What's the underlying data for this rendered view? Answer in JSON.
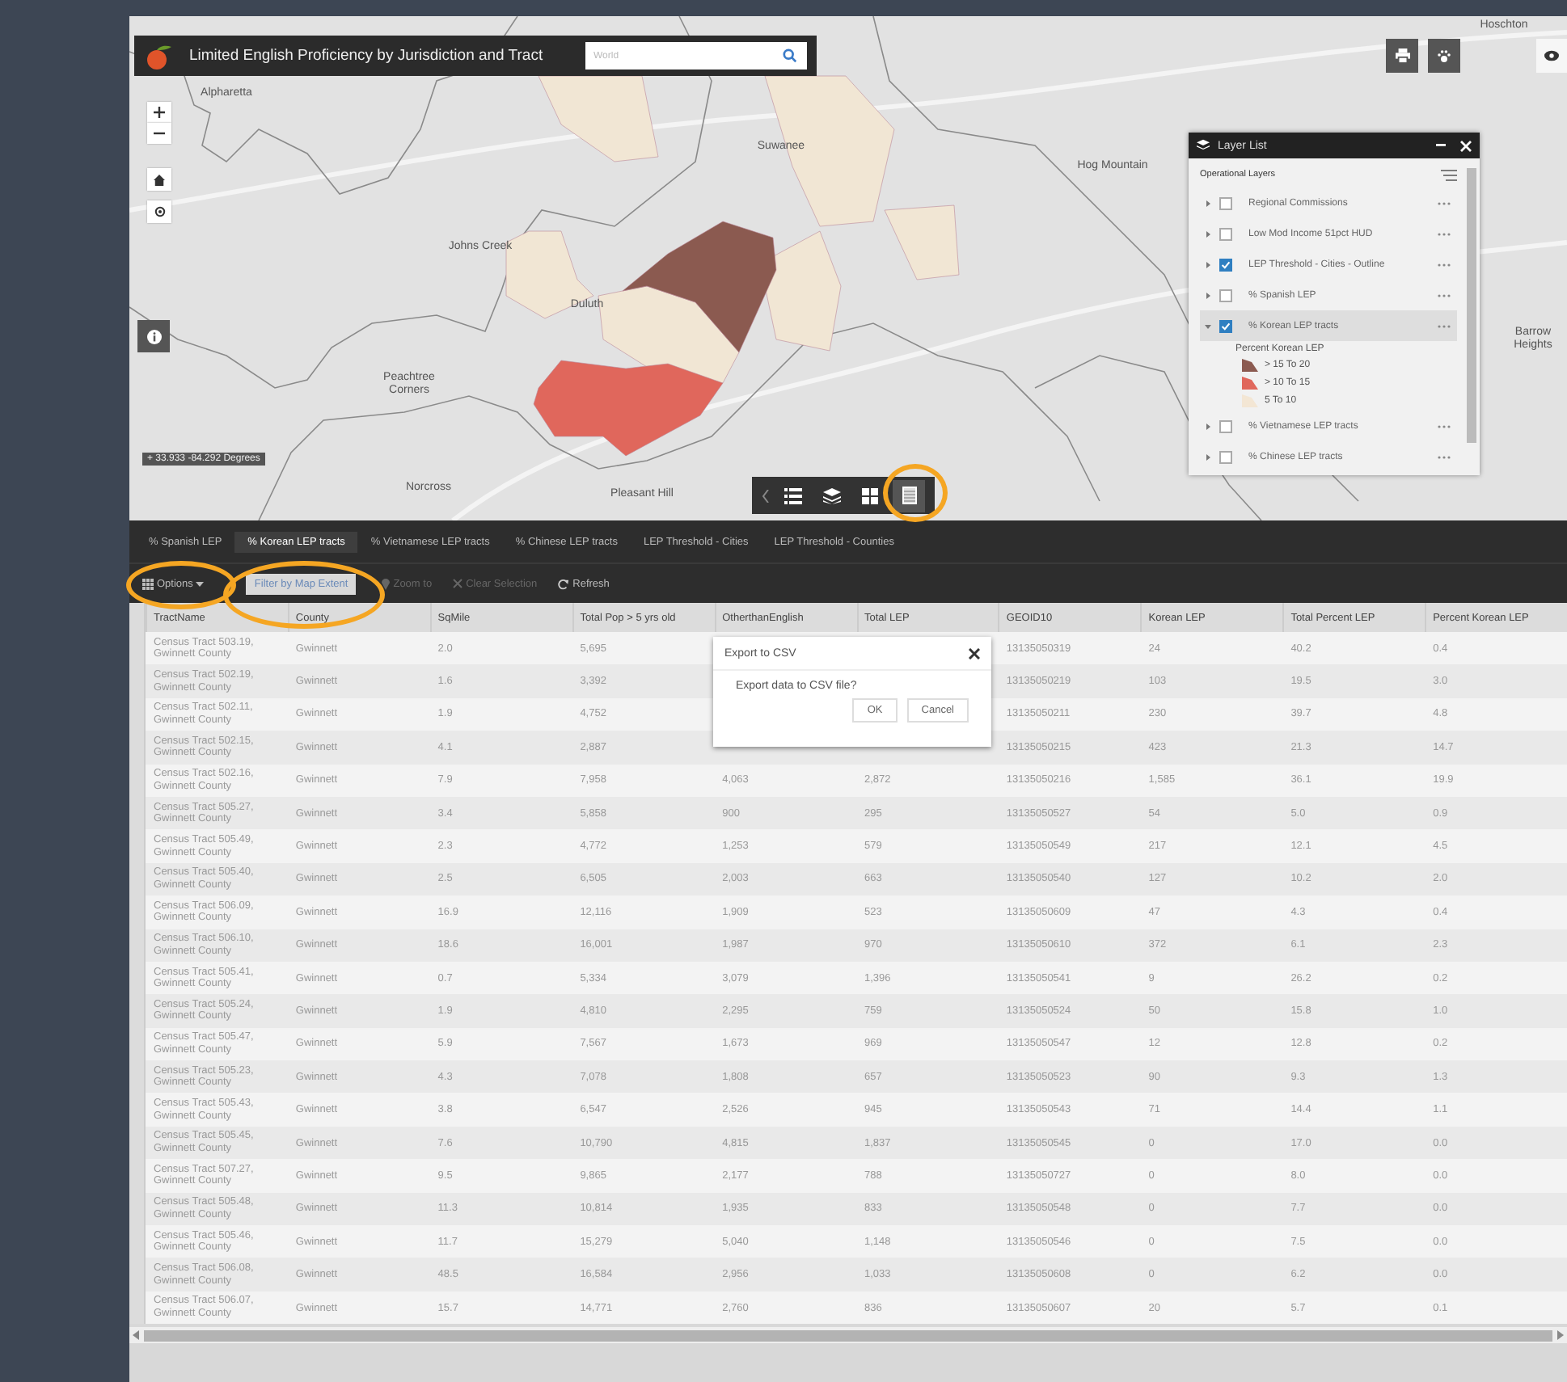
{
  "app": {
    "title": "Limited English Proficiency by Jurisdiction and Tract",
    "search": {
      "placeholder": "World"
    }
  },
  "map": {
    "labels": [
      "Alpharetta",
      "Johns Creek",
      "Peachtree Corners",
      "Suwanee",
      "Duluth",
      "Norcross",
      "Pleasant Hill",
      "Hog Mountain",
      "Barrow Heights",
      "Hoschton"
    ],
    "coordinates": "+ 33.933 -84.292 Degrees"
  },
  "map_toolbar": [
    {
      "kind": "list",
      "selected": false
    },
    {
      "kind": "layers",
      "selected": false
    },
    {
      "kind": "grid",
      "selected": false
    },
    {
      "kind": "table",
      "selected": true
    }
  ],
  "layer_list": {
    "title": "Layer List",
    "section": "Operational Layers",
    "layers": [
      {
        "name": "Regional Commissions",
        "checked": false,
        "expanded": false,
        "selected": false
      },
      {
        "name": "Low Mod Income 51pct HUD",
        "checked": false,
        "expanded": false,
        "selected": false
      },
      {
        "name": "LEP Threshold - Cities - Outline",
        "checked": true,
        "expanded": false,
        "selected": false
      },
      {
        "name": "% Spanish LEP",
        "checked": false,
        "expanded": false,
        "selected": false
      },
      {
        "name": "% Korean LEP tracts",
        "checked": true,
        "expanded": true,
        "selected": true,
        "legend": {
          "title": "Percent Korean LEP",
          "entries": [
            {
              "label": "> 15 To 20",
              "color": "#8b5a50"
            },
            {
              "label": "> 10 To 15",
              "color": "#e0675c"
            },
            {
              "label": "5 To 10",
              "color": "#f3e6d4"
            }
          ]
        }
      },
      {
        "name": "% Vietnamese LEP tracts",
        "checked": false,
        "expanded": false,
        "selected": false
      },
      {
        "name": "% Chinese LEP tracts",
        "checked": false,
        "expanded": false,
        "selected": false
      }
    ]
  },
  "tabs": [
    {
      "label": "% Spanish LEP",
      "selected": false
    },
    {
      "label": "% Korean LEP tracts",
      "selected": true
    },
    {
      "label": "% Vietnamese LEP tracts",
      "selected": false
    },
    {
      "label": "% Chinese LEP tracts",
      "selected": false
    },
    {
      "label": "LEP Threshold - Cities",
      "selected": false
    },
    {
      "label": "LEP Threshold - Counties",
      "selected": false
    }
  ],
  "toolbar": [
    {
      "kind": "options",
      "label": "Options",
      "disabled": false,
      "on": false
    },
    {
      "kind": "filter",
      "label": "Filter by Map Extent",
      "disabled": false,
      "on": true
    },
    {
      "kind": "zoom",
      "label": "Zoom to",
      "disabled": true,
      "on": false
    },
    {
      "kind": "clear",
      "label": "Clear Selection",
      "disabled": true,
      "on": false
    },
    {
      "kind": "refresh",
      "label": "Refresh",
      "disabled": false,
      "on": false
    }
  ],
  "table": {
    "columns": [
      "TractName",
      "County",
      "SqMile",
      "Total Pop > 5 yrs old",
      "OtherthanEnglish",
      "Total LEP",
      "GEOID10",
      "Korean LEP",
      "Total Percent LEP",
      "Percent Korean LEP"
    ],
    "rows": [
      [
        "Census Tract 503.19, Gwinnett County",
        "Gwinnett",
        "2.0",
        "5,695",
        null,
        null,
        "13135050319",
        "24",
        "40.2",
        "0.4"
      ],
      [
        "Census Tract 502.19, Gwinnett County",
        "Gwinnett",
        "1.6",
        "3,392",
        null,
        null,
        "13135050219",
        "103",
        "19.5",
        "3.0"
      ],
      [
        "Census Tract 502.11, Gwinnett County",
        "Gwinnett",
        "1.9",
        "4,752",
        null,
        null,
        "13135050211",
        "230",
        "39.7",
        "4.8"
      ],
      [
        "Census Tract 502.15, Gwinnett County",
        "Gwinnett",
        "4.1",
        "2,887",
        null,
        null,
        "13135050215",
        "423",
        "21.3",
        "14.7"
      ],
      [
        "Census Tract 502.16, Gwinnett County",
        "Gwinnett",
        "7.9",
        "7,958",
        "4,063",
        "2,872",
        "13135050216",
        "1,585",
        "36.1",
        "19.9"
      ],
      [
        "Census Tract 505.27, Gwinnett County",
        "Gwinnett",
        "3.4",
        "5,858",
        "900",
        "295",
        "13135050527",
        "54",
        "5.0",
        "0.9"
      ],
      [
        "Census Tract 505.49, Gwinnett County",
        "Gwinnett",
        "2.3",
        "4,772",
        "1,253",
        "579",
        "13135050549",
        "217",
        "12.1",
        "4.5"
      ],
      [
        "Census Tract 505.40, Gwinnett County",
        "Gwinnett",
        "2.5",
        "6,505",
        "2,003",
        "663",
        "13135050540",
        "127",
        "10.2",
        "2.0"
      ],
      [
        "Census Tract 506.09, Gwinnett County",
        "Gwinnett",
        "16.9",
        "12,116",
        "1,909",
        "523",
        "13135050609",
        "47",
        "4.3",
        "0.4"
      ],
      [
        "Census Tract 506.10, Gwinnett County",
        "Gwinnett",
        "18.6",
        "16,001",
        "1,987",
        "970",
        "13135050610",
        "372",
        "6.1",
        "2.3"
      ],
      [
        "Census Tract 505.41, Gwinnett County",
        "Gwinnett",
        "0.7",
        "5,334",
        "3,079",
        "1,396",
        "13135050541",
        "9",
        "26.2",
        "0.2"
      ],
      [
        "Census Tract 505.24, Gwinnett County",
        "Gwinnett",
        "1.9",
        "4,810",
        "2,295",
        "759",
        "13135050524",
        "50",
        "15.8",
        "1.0"
      ],
      [
        "Census Tract 505.47, Gwinnett County",
        "Gwinnett",
        "5.9",
        "7,567",
        "1,673",
        "969",
        "13135050547",
        "12",
        "12.8",
        "0.2"
      ],
      [
        "Census Tract 505.23, Gwinnett County",
        "Gwinnett",
        "4.3",
        "7,078",
        "1,808",
        "657",
        "13135050523",
        "90",
        "9.3",
        "1.3"
      ],
      [
        "Census Tract 505.43, Gwinnett County",
        "Gwinnett",
        "3.8",
        "6,547",
        "2,526",
        "945",
        "13135050543",
        "71",
        "14.4",
        "1.1"
      ],
      [
        "Census Tract 505.45, Gwinnett County",
        "Gwinnett",
        "7.6",
        "10,790",
        "4,815",
        "1,837",
        "13135050545",
        "0",
        "17.0",
        "0.0"
      ],
      [
        "Census Tract 507.27, Gwinnett County",
        "Gwinnett",
        "9.5",
        "9,865",
        "2,177",
        "788",
        "13135050727",
        "0",
        "8.0",
        "0.0"
      ],
      [
        "Census Tract 505.48, Gwinnett County",
        "Gwinnett",
        "11.3",
        "10,814",
        "1,935",
        "833",
        "13135050548",
        "0",
        "7.7",
        "0.0"
      ],
      [
        "Census Tract 505.46, Gwinnett County",
        "Gwinnett",
        "11.7",
        "15,279",
        "5,040",
        "1,148",
        "13135050546",
        "0",
        "7.5",
        "0.0"
      ],
      [
        "Census Tract 506.08, Gwinnett County",
        "Gwinnett",
        "48.5",
        "16,584",
        "2,956",
        "1,033",
        "13135050608",
        "0",
        "6.2",
        "0.0"
      ],
      [
        "Census Tract 506.07, Gwinnett County",
        "Gwinnett",
        "15.7",
        "14,771",
        "2,760",
        "836",
        "13135050607",
        "20",
        "5.7",
        "0.1"
      ]
    ]
  },
  "dialog": {
    "title": "Export to CSV",
    "message": "Export data to CSV file?",
    "buttons": [
      "OK",
      "Cancel"
    ]
  }
}
